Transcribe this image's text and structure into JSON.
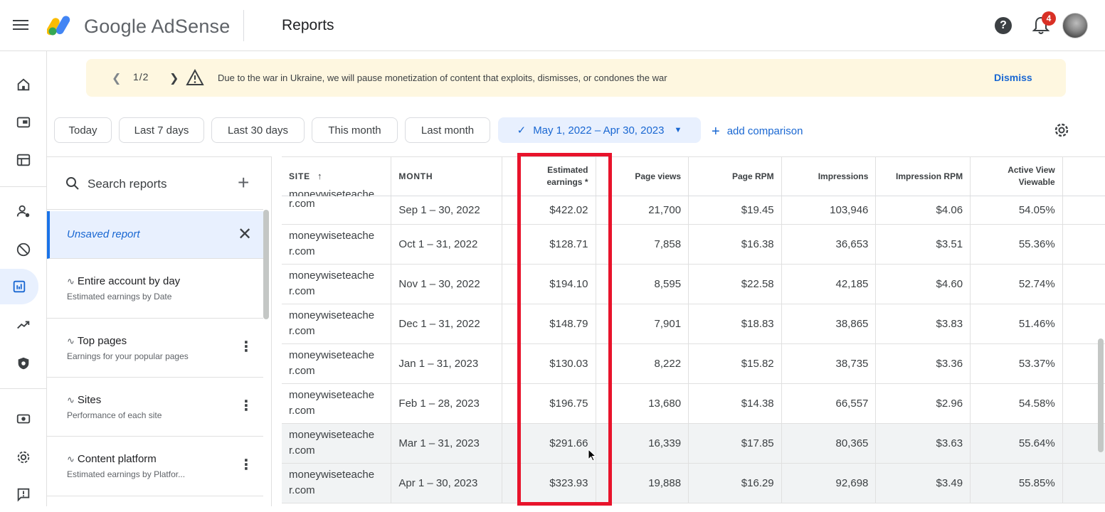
{
  "app": {
    "brand": "Google AdSense",
    "page_title": "Reports",
    "notification_count": "4"
  },
  "banner": {
    "counter": "1/2",
    "message": "Due to the war in Ukraine, we will pause monetization of content that exploits, dismisses, or condones the war",
    "dismiss_label": "Dismiss"
  },
  "date_chips": [
    "Today",
    "Last 7 days",
    "Last 30 days",
    "This month",
    "Last month"
  ],
  "date_range": "May 1, 2022 – Apr 30, 2023",
  "add_comparison_label": "add comparison",
  "panel": {
    "search_placeholder": "Search reports",
    "unsaved_label": "Unsaved report",
    "reports": [
      {
        "title": "Entire account by day",
        "subtitle": "Estimated earnings by Date"
      },
      {
        "title": "Top pages",
        "subtitle": "Earnings for your popular pages"
      },
      {
        "title": "Sites",
        "subtitle": "Performance of each site"
      },
      {
        "title": "Content platform",
        "subtitle": "Estimated earnings by Platfor..."
      }
    ]
  },
  "table": {
    "headers": {
      "site": "SITE",
      "month": "MONTH",
      "earnings_line1": "Estimated",
      "earnings_line2": "earnings *",
      "page_views": "Page views",
      "page_rpm": "Page RPM",
      "impressions": "Impressions",
      "impression_rpm": "Impression RPM",
      "active_view_line1": "Active View",
      "active_view_line2": "Viewable"
    },
    "partial_site": "moneywiseteache",
    "rows": [
      {
        "site1": "moneywiseteache",
        "site2": "r.com",
        "month": "Sep 1 – 30, 2022",
        "earnings": "$422.02",
        "page_views": "21,700",
        "page_rpm": "$19.45",
        "impressions": "103,946",
        "impression_rpm": "$4.06",
        "active_view": "54.05%"
      },
      {
        "site1": "moneywiseteache",
        "site2": "r.com",
        "month": "Oct 1 – 31, 2022",
        "earnings": "$128.71",
        "page_views": "7,858",
        "page_rpm": "$16.38",
        "impressions": "36,653",
        "impression_rpm": "$3.51",
        "active_view": "55.36%"
      },
      {
        "site1": "moneywiseteache",
        "site2": "r.com",
        "month": "Nov 1 – 30, 2022",
        "earnings": "$194.10",
        "page_views": "8,595",
        "page_rpm": "$22.58",
        "impressions": "42,185",
        "impression_rpm": "$4.60",
        "active_view": "52.74%"
      },
      {
        "site1": "moneywiseteache",
        "site2": "r.com",
        "month": "Dec 1 – 31, 2022",
        "earnings": "$148.79",
        "page_views": "7,901",
        "page_rpm": "$18.83",
        "impressions": "38,865",
        "impression_rpm": "$3.83",
        "active_view": "51.46%"
      },
      {
        "site1": "moneywiseteache",
        "site2": "r.com",
        "month": "Jan 1 – 31, 2023",
        "earnings": "$130.03",
        "page_views": "8,222",
        "page_rpm": "$15.82",
        "impressions": "38,735",
        "impression_rpm": "$3.36",
        "active_view": "53.37%"
      },
      {
        "site1": "moneywiseteache",
        "site2": "r.com",
        "month": "Feb 1 – 28, 2023",
        "earnings": "$196.75",
        "page_views": "13,680",
        "page_rpm": "$14.38",
        "impressions": "66,557",
        "impression_rpm": "$2.96",
        "active_view": "54.58%"
      },
      {
        "site1": "moneywiseteache",
        "site2": "r.com",
        "month": "Mar 1 – 31, 2023",
        "earnings": "$291.66",
        "page_views": "16,339",
        "page_rpm": "$17.85",
        "impressions": "80,365",
        "impression_rpm": "$3.63",
        "active_view": "55.64%"
      },
      {
        "site1": "moneywiseteache",
        "site2": "r.com",
        "month": "Apr 1 – 30, 2023",
        "earnings": "$323.93",
        "page_views": "19,888",
        "page_rpm": "$16.29",
        "impressions": "92,698",
        "impression_rpm": "$3.49",
        "active_view": "55.85%"
      }
    ]
  },
  "colors": {
    "accent": "#1967d2",
    "highlight": "#e8132b",
    "banner_bg": "#fef7e0"
  }
}
